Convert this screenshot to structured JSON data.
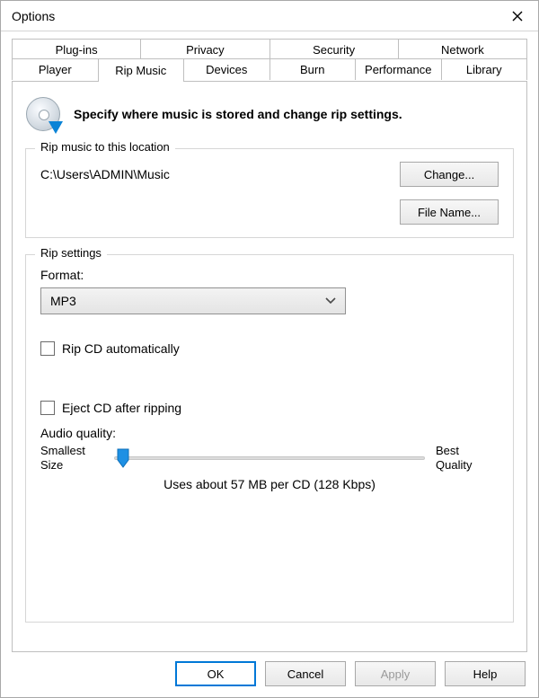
{
  "window": {
    "title": "Options"
  },
  "tabs": {
    "row1": [
      "Plug-ins",
      "Privacy",
      "Security",
      "Network"
    ],
    "row2": [
      "Player",
      "Rip Music",
      "Devices",
      "Burn",
      "Performance",
      "Library"
    ],
    "active": "Rip Music"
  },
  "description": "Specify where music is stored and change rip settings.",
  "location": {
    "legend": "Rip music to this location",
    "path": "C:\\Users\\ADMIN\\Music",
    "change_label": "Change...",
    "filename_label": "File Name..."
  },
  "rip": {
    "legend": "Rip settings",
    "format_label": "Format:",
    "format_value": "MP3",
    "auto_label": "Rip CD automatically",
    "auto_checked": false,
    "eject_label": "Eject CD after ripping",
    "eject_checked": false,
    "audio_quality_label": "Audio quality:",
    "slider_left": "Smallest\nSize",
    "slider_right": "Best\nQuality",
    "slider_hint": "Uses about 57 MB per CD (128 Kbps)",
    "slider_position_pct": 3
  },
  "buttons": {
    "ok": "OK",
    "cancel": "Cancel",
    "apply": "Apply",
    "help": "Help"
  }
}
